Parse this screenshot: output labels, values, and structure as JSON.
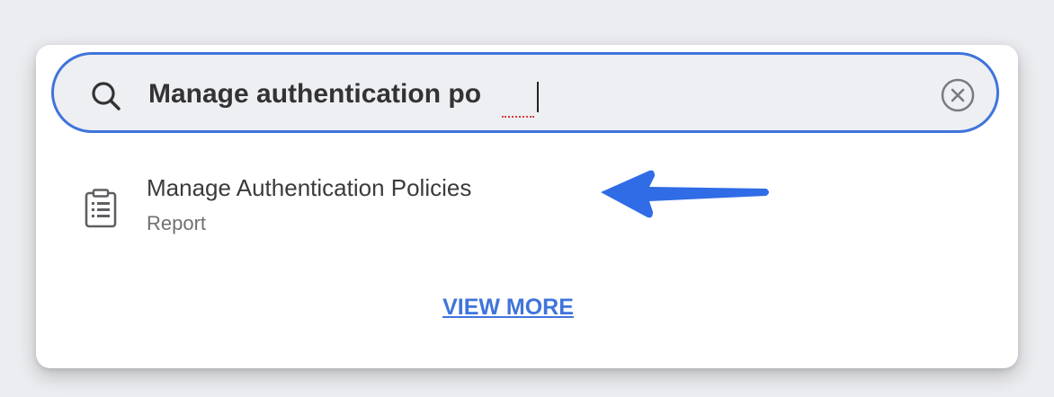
{
  "search": {
    "value": "Manage authentication po",
    "icon": "search-icon",
    "clear_icon": "close-circle-icon"
  },
  "results": [
    {
      "title": "Manage Authentication Policies",
      "type": "Report",
      "icon": "report-document-icon"
    }
  ],
  "annotation": {
    "arrow_color": "#2f6ce6",
    "arrow_icon": "arrow-left-icon"
  },
  "footer": {
    "view_more_label": "VIEW MORE"
  },
  "colors": {
    "accent": "#3f74db",
    "background": "#ecedf0"
  }
}
